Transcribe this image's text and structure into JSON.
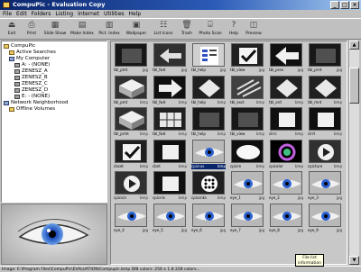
{
  "window": {
    "title": "CompuPic - Evaluation Copy"
  },
  "menu": [
    "File",
    "Edit",
    "Folders",
    "Listing",
    "Internet",
    "Utilities",
    "Help"
  ],
  "toolbar": [
    {
      "label": "Exit",
      "icon": "exit-icon"
    },
    {
      "label": "Print",
      "icon": "print-icon"
    },
    {
      "label": "Slide Show",
      "icon": "slideshow-icon"
    },
    {
      "label": "Make Index",
      "icon": "make-index-icon"
    },
    {
      "label": "Pict. Index",
      "icon": "pict-index-icon"
    },
    {
      "label": "Wallpaper",
      "icon": "wallpaper-icon"
    },
    {
      "label": "List Icons",
      "icon": "list-icons-icon"
    },
    {
      "label": "Trash",
      "icon": "trash-icon"
    },
    {
      "label": "Photo Scan",
      "icon": "photoscan-icon"
    },
    {
      "label": "Help",
      "icon": "help-icon"
    },
    {
      "label": "Preview",
      "icon": "preview-icon"
    }
  ],
  "tree": [
    {
      "label": "CompuPic",
      "indent": 0,
      "kind": "folder"
    },
    {
      "label": "Active Searches",
      "indent": 1,
      "kind": "folder"
    },
    {
      "label": "My Computer",
      "indent": 1,
      "kind": "comp"
    },
    {
      "label": "A: - (NONE)",
      "indent": 2,
      "kind": "drive"
    },
    {
      "label": "ZENESZ_A",
      "indent": 2,
      "kind": "drive"
    },
    {
      "label": "ZENESZ_B",
      "indent": 2,
      "kind": "drive"
    },
    {
      "label": "ZENESZ_C",
      "indent": 2,
      "kind": "drive"
    },
    {
      "label": "ZENESZ_D",
      "indent": 2,
      "kind": "drive"
    },
    {
      "label": "E: - (NONE)",
      "indent": 2,
      "kind": "drive"
    },
    {
      "label": "Network Neighborhood",
      "indent": 0,
      "kind": "comp"
    },
    {
      "label": "Offline Volumes",
      "indent": 1,
      "kind": "folder"
    }
  ],
  "thumbnails": [
    {
      "name": "tbl_pmt",
      "ext": "jpg",
      "style": "dark"
    },
    {
      "name": "tbl_fwd",
      "ext": "jpg",
      "style": "arrows"
    },
    {
      "name": "tbl_help",
      "ext": "jpg",
      "style": "doc"
    },
    {
      "name": "tbl_view",
      "ext": "jpg",
      "style": "check"
    },
    {
      "name": "tbl_prev",
      "ext": "jpg",
      "style": "arrowleft"
    },
    {
      "name": "tbl_prnt",
      "ext": "jpg",
      "style": "dark"
    },
    {
      "name": "tbl_pmt",
      "ext": "bmp",
      "style": "cube"
    },
    {
      "name": "tbl_fwd",
      "ext": "bmp",
      "style": "arrowright"
    },
    {
      "name": "tbl_help",
      "ext": "bmp",
      "style": "diamond"
    },
    {
      "name": "tbl_exct",
      "ext": "bmp",
      "style": "mesh"
    },
    {
      "name": "tbl_ord",
      "ext": "bmp",
      "style": "diamond"
    },
    {
      "name": "tbl_mnt",
      "ext": "bmp",
      "style": "diamond"
    },
    {
      "name": "tbl_prmt",
      "ext": "bmp",
      "style": "cube"
    },
    {
      "name": "tbl_fwd",
      "ext": "bmp",
      "style": "grid"
    },
    {
      "name": "tbl_help",
      "ext": "bmp",
      "style": "dark"
    },
    {
      "name": "tbl_view",
      "ext": "bmp",
      "style": "dark"
    },
    {
      "name": "clrrc",
      "ext": "bmp",
      "style": "plain"
    },
    {
      "name": "clrrt",
      "ext": "bmp",
      "style": "plain"
    },
    {
      "name": "cbset",
      "ext": "bmp",
      "style": "check"
    },
    {
      "name": "cbnt",
      "ext": "bmp",
      "style": "plain"
    },
    {
      "name": "cpicrus",
      "ext": "bmp",
      "style": "eye"
    },
    {
      "name": "cpicre",
      "ext": "bmp",
      "style": "blur"
    },
    {
      "name": "cpicolor",
      "ext": "bmp",
      "style": "ring"
    },
    {
      "name": "cpicture",
      "ext": "bmp",
      "style": "play"
    },
    {
      "name": "cpicvin",
      "ext": "bmp",
      "style": "play"
    },
    {
      "name": "cpicnls",
      "ext": "bmp",
      "style": "plain"
    },
    {
      "name": "cpicsnks",
      "ext": "bmp",
      "style": "dots"
    },
    {
      "name": "eye_1",
      "ext": "jpg",
      "style": "eye"
    },
    {
      "name": "eye_2",
      "ext": "jpg",
      "style": "eye"
    },
    {
      "name": "eye_3",
      "ext": "jpg",
      "style": "eye"
    },
    {
      "name": "eye_4",
      "ext": "jpg",
      "style": "eye"
    },
    {
      "name": "eye_5",
      "ext": "jpg",
      "style": "eye"
    },
    {
      "name": "eye_6",
      "ext": "jpg",
      "style": "eye"
    },
    {
      "name": "eye_7",
      "ext": "jpg",
      "style": "eye"
    },
    {
      "name": "eye_8",
      "ext": "jpg",
      "style": "eye"
    },
    {
      "name": "eye_9",
      "ext": "jpg",
      "style": "eye"
    }
  ],
  "selected_index": 20,
  "tooltip": "File list information",
  "status": "Image: E:\\Program Files\\CompuPic\\EVALUATION\\Compupic.bmp  DIB  colors: 256 x 1.8  228 colors..."
}
